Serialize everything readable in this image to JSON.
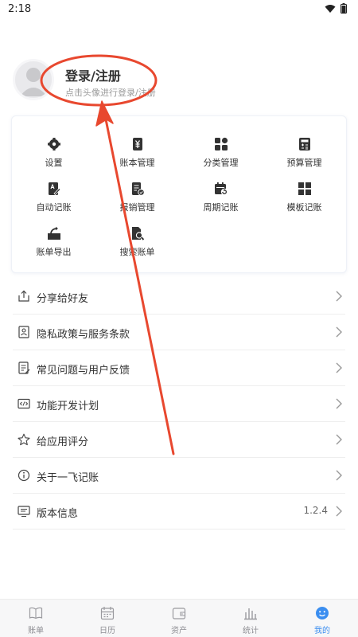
{
  "status_bar": {
    "time": "2:18"
  },
  "profile": {
    "title": "登录/注册",
    "subtitle": "点击头像进行登录/注册"
  },
  "grid": [
    {
      "label": "设置",
      "icon": "gear-icon"
    },
    {
      "label": "账本管理",
      "icon": "ledger-icon"
    },
    {
      "label": "分类管理",
      "icon": "category-icon"
    },
    {
      "label": "预算管理",
      "icon": "calculator-icon"
    },
    {
      "label": "自动记账",
      "icon": "auto-record-icon"
    },
    {
      "label": "报销管理",
      "icon": "reimburse-icon"
    },
    {
      "label": "周期记账",
      "icon": "calendar-cycle-icon"
    },
    {
      "label": "模板记账",
      "icon": "template-icon"
    },
    {
      "label": "账单导出",
      "icon": "export-icon"
    },
    {
      "label": "搜索账单",
      "icon": "search-bill-icon"
    }
  ],
  "menu": [
    {
      "label": "分享给好友",
      "icon": "share-icon"
    },
    {
      "label": "隐私政策与服务条款",
      "icon": "privacy-icon"
    },
    {
      "label": "常见问题与用户反馈",
      "icon": "feedback-icon"
    },
    {
      "label": "功能开发计划",
      "icon": "code-icon"
    },
    {
      "label": "给应用评分",
      "icon": "star-icon"
    },
    {
      "label": "关于一飞记账",
      "icon": "info-icon"
    },
    {
      "label": "版本信息",
      "icon": "monitor-icon",
      "value": "1.2.4"
    }
  ],
  "tabs": [
    {
      "label": "账单",
      "icon": "book-icon",
      "active": false
    },
    {
      "label": "日历",
      "icon": "calendar-icon",
      "active": false
    },
    {
      "label": "资产",
      "icon": "wallet-icon",
      "active": false
    },
    {
      "label": "统计",
      "icon": "bar-chart-icon",
      "active": false
    },
    {
      "label": "我的",
      "icon": "smile-icon",
      "active": true
    }
  ],
  "colors": {
    "accent": "#3b8ef0",
    "annotation": "#e8482f",
    "icon": "#333333"
  }
}
